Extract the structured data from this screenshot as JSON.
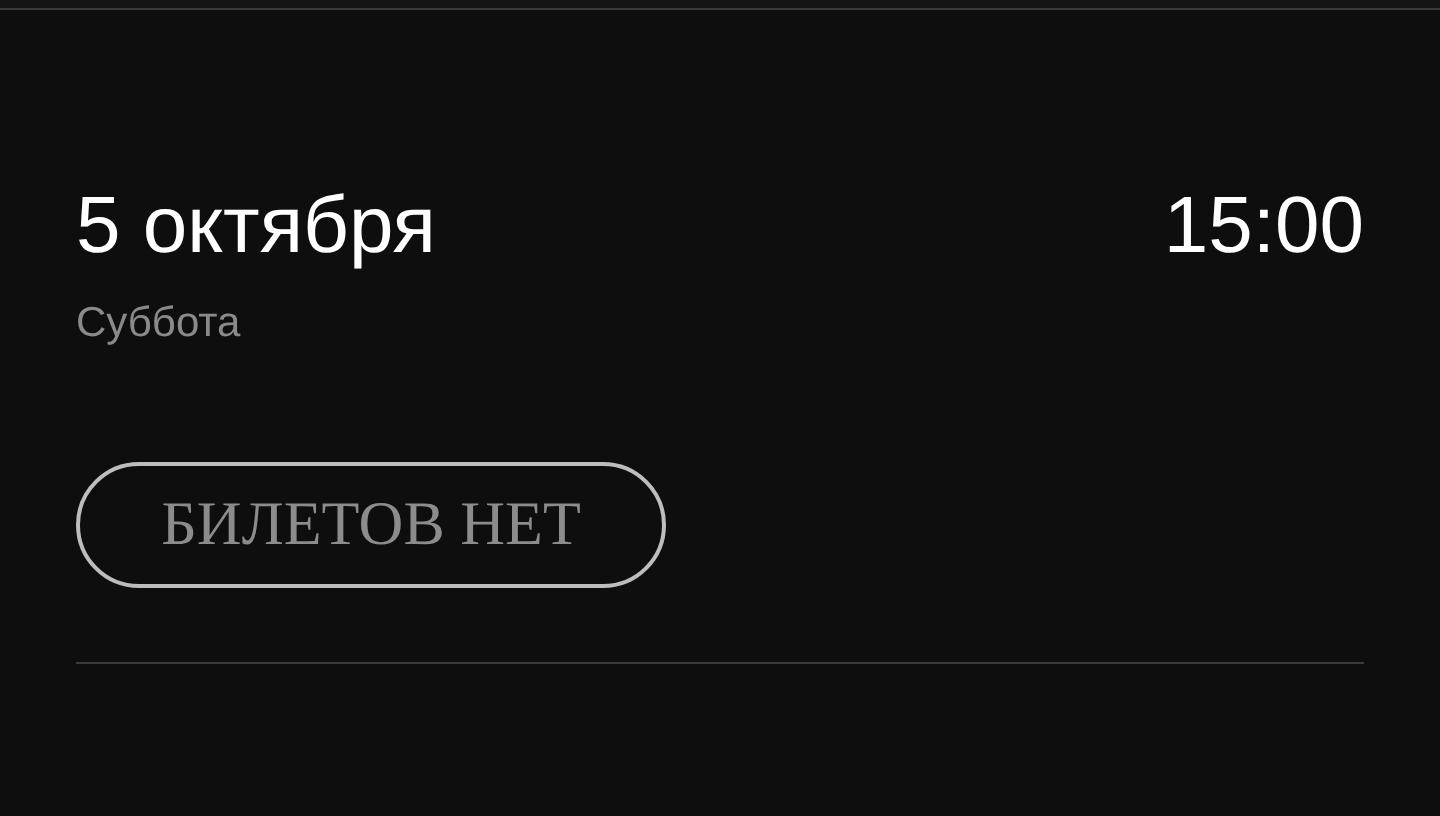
{
  "event": {
    "date": "5 октября",
    "time": "15:00",
    "weekday": "Суббота"
  },
  "ticket_button": {
    "label": "БИЛЕТОВ НЕТ",
    "disabled": true
  }
}
